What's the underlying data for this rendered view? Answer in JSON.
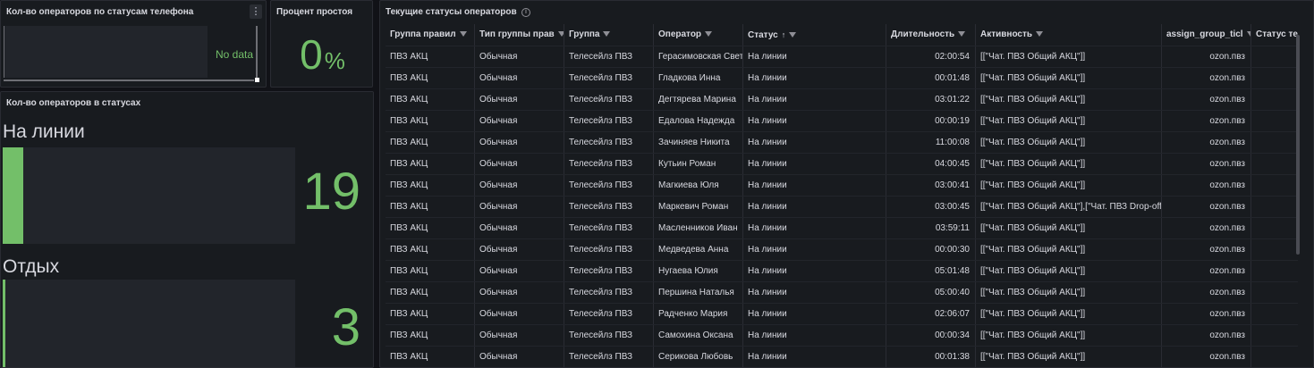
{
  "panel_phone_status": {
    "title": "Кол-во операторов по статусам телефона",
    "no_data": "No data",
    "menu_icon": "⋮"
  },
  "panel_idle": {
    "title": "Процент простоя",
    "value": "0",
    "unit": "%"
  },
  "panel_status_counts": {
    "title": "Кол-во операторов в статусах",
    "gauges": [
      {
        "label": "На линии",
        "value": "19",
        "fill_percent": 7,
        "color": "#73bf69"
      },
      {
        "label": "Отдых",
        "value": "3",
        "fill_percent": 1,
        "color": "#73bf69"
      }
    ]
  },
  "table": {
    "title": "Текущие статусы операторов",
    "info_icon": "info-circle-icon",
    "headers": [
      "Группа правил",
      "Тип группы прав",
      "Группа",
      "Оператор",
      "Статус",
      "Длительность",
      "Активность",
      "assign_group_ticl",
      "Статус теле"
    ],
    "sort_indicator": "↑",
    "rows": [
      [
        "ПВЗ АКЦ",
        "Обычная",
        "Телесейлз ПВЗ",
        "Герасимовская Светлана",
        "На линии",
        "02:00:54",
        "[[\"Чат. ПВЗ Общий АКЦ\"]]",
        "ozon.пвз",
        ""
      ],
      [
        "ПВЗ АКЦ",
        "Обычная",
        "Телесейлз ПВЗ",
        "Гладкова Инна",
        "На линии",
        "00:01:48",
        "[[\"Чат. ПВЗ Общий АКЦ\"]]",
        "ozon.пвз",
        ""
      ],
      [
        "ПВЗ АКЦ",
        "Обычная",
        "Телесейлз ПВЗ",
        "Дегтярева Марина",
        "На линии",
        "03:01:22",
        "[[\"Чат. ПВЗ Общий АКЦ\"]]",
        "ozon.пвз",
        ""
      ],
      [
        "ПВЗ АКЦ",
        "Обычная",
        "Телесейлз ПВЗ",
        "Едалова Надежда",
        "На линии",
        "00:00:19",
        "[[\"Чат. ПВЗ Общий АКЦ\"]]",
        "ozon.пвз",
        ""
      ],
      [
        "ПВЗ АКЦ",
        "Обычная",
        "Телесейлз ПВЗ",
        "Зачиняев Никита",
        "На линии",
        "11:00:08",
        "[[\"Чат. ПВЗ Общий АКЦ\"]]",
        "ozon.пвз",
        ""
      ],
      [
        "ПВЗ АКЦ",
        "Обычная",
        "Телесейлз ПВЗ",
        "Кутьин Роман",
        "На линии",
        "04:00:45",
        "[[\"Чат. ПВЗ Общий АКЦ\"]]",
        "ozon.пвз",
        ""
      ],
      [
        "ПВЗ АКЦ",
        "Обычная",
        "Телесейлз ПВЗ",
        "Магкиева Юля",
        "На линии",
        "03:00:41",
        "[[\"Чат. ПВЗ Общий АКЦ\"]]",
        "ozon.пвз",
        ""
      ],
      [
        "ПВЗ АКЦ",
        "Обычная",
        "Телесейлз ПВЗ",
        "Маркевич Роман",
        "На линии",
        "03:00:45",
        "[[\"Чат. ПВЗ Общий АКЦ\"],[\"Чат. ПВЗ Drop-off\"]]",
        "ozon.пвз",
        ""
      ],
      [
        "ПВЗ АКЦ",
        "Обычная",
        "Телесейлз ПВЗ",
        "Масленников Иван",
        "На линии",
        "03:59:11",
        "[[\"Чат. ПВЗ Общий АКЦ\"]]",
        "ozon.пвз",
        ""
      ],
      [
        "ПВЗ АКЦ",
        "Обычная",
        "Телесейлз ПВЗ",
        "Медведева Анна",
        "На линии",
        "00:00:30",
        "[[\"Чат. ПВЗ Общий АКЦ\"]]",
        "ozon.пвз",
        ""
      ],
      [
        "ПВЗ АКЦ",
        "Обычная",
        "Телесейлз ПВЗ",
        "Нугаева Юлия",
        "На линии",
        "05:01:48",
        "[[\"Чат. ПВЗ Общий АКЦ\"]]",
        "ozon.пвз",
        ""
      ],
      [
        "ПВЗ АКЦ",
        "Обычная",
        "Телесейлз ПВЗ",
        "Першина Наталья",
        "На линии",
        "05:00:40",
        "[[\"Чат. ПВЗ Общий АКЦ\"]]",
        "ozon.пвз",
        ""
      ],
      [
        "ПВЗ АКЦ",
        "Обычная",
        "Телесейлз ПВЗ",
        "Радченко Мария",
        "На линии",
        "02:06:07",
        "[[\"Чат. ПВЗ Общий АКЦ\"]]",
        "ozon.пвз",
        ""
      ],
      [
        "ПВЗ АКЦ",
        "Обычная",
        "Телесейлз ПВЗ",
        "Самохина Оксана",
        "На линии",
        "00:00:34",
        "[[\"Чат. ПВЗ Общий АКЦ\"]]",
        "ozon.пвз",
        ""
      ],
      [
        "ПВЗ АКЦ",
        "Обычная",
        "Телесейлз ПВЗ",
        "Серикова Любовь",
        "На линии",
        "00:01:38",
        "[[\"Чат. ПВЗ Общий АКЦ\"]]",
        "ozon.пвз",
        ""
      ]
    ]
  }
}
